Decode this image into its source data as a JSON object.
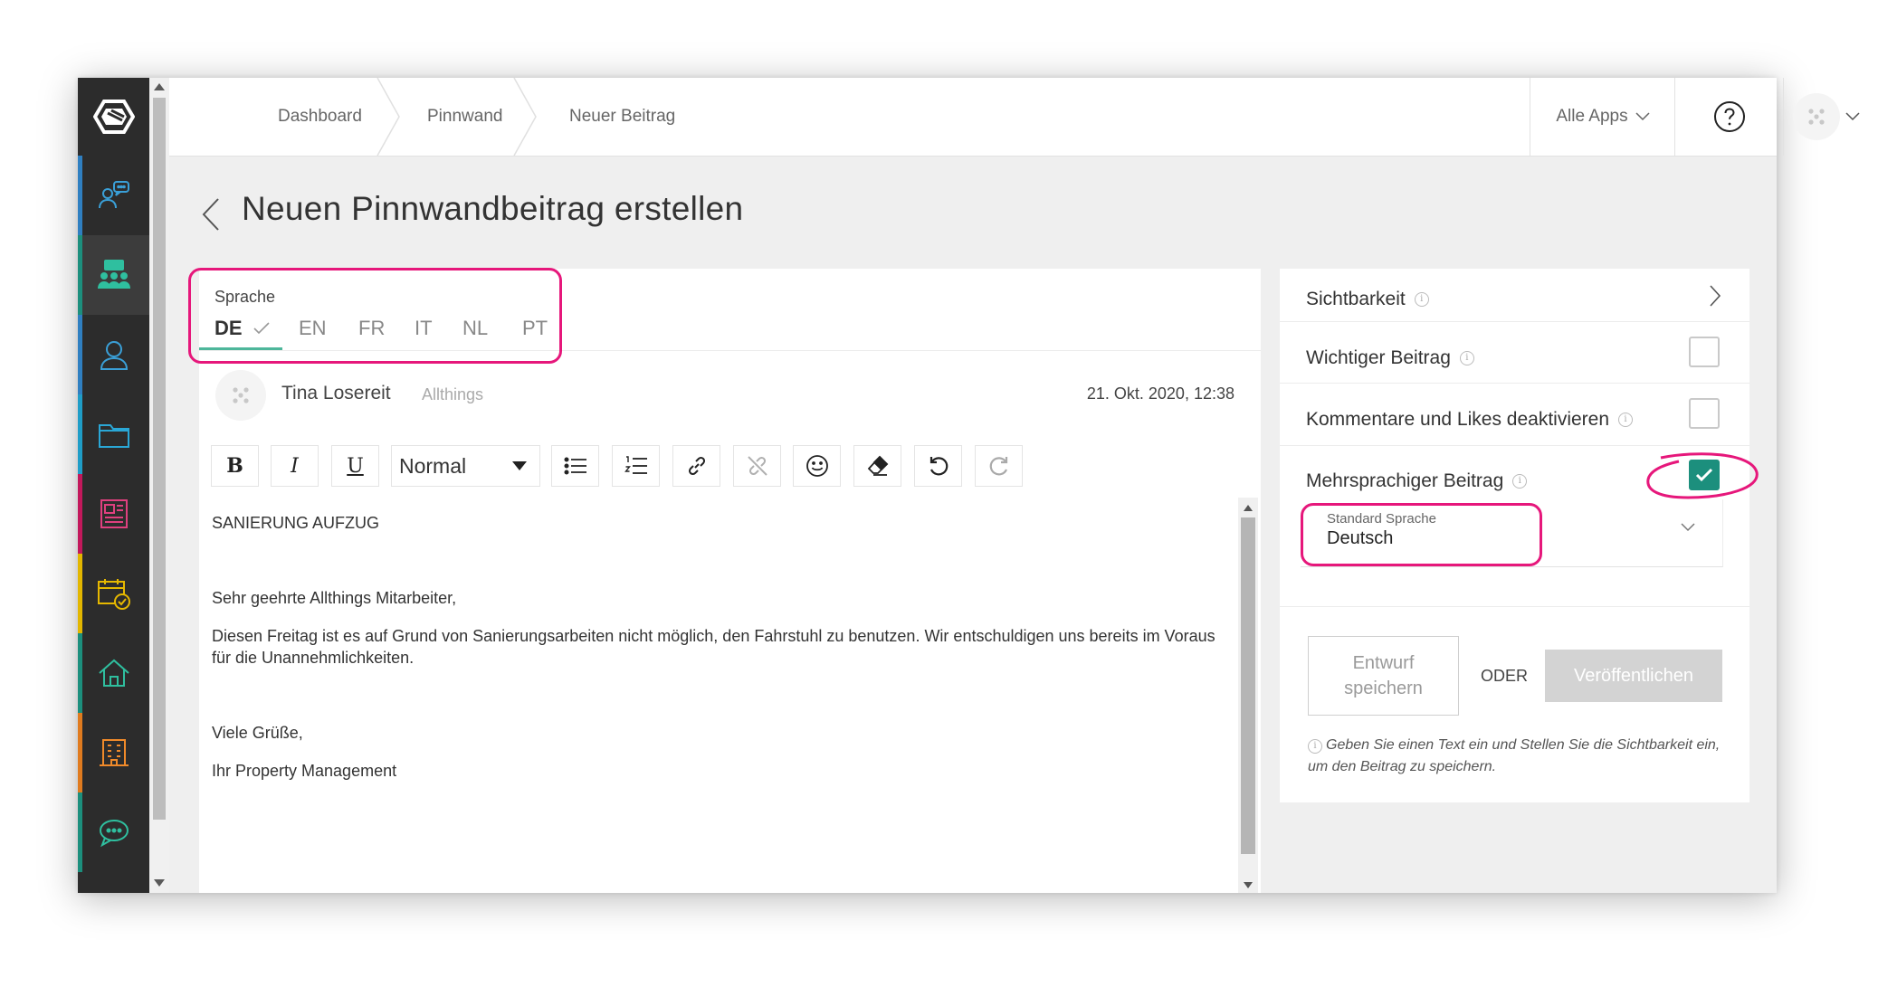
{
  "header": {
    "breadcrumb": [
      "Dashboard",
      "Pinnwand",
      "Neuer Beitrag"
    ],
    "apps_label": "Alle Apps"
  },
  "sidebar": {
    "icons": [
      {
        "name": "chat-bubbles-icon",
        "stripe": "#2f7fc1"
      },
      {
        "name": "community-icon",
        "stripe": "#1c8f7d"
      },
      {
        "name": "person-icon",
        "stripe": "#2f7fc1"
      },
      {
        "name": "folder-icon",
        "stripe": "#1f9dc7"
      },
      {
        "name": "newspaper-icon",
        "stripe": "#c2185b"
      },
      {
        "name": "calendar-check-icon",
        "stripe": "#e2b600"
      },
      {
        "name": "home-icon",
        "stripe": "#1c8f7d"
      },
      {
        "name": "building-icon",
        "stripe": "#e07b1f"
      },
      {
        "name": "chat-dots-icon",
        "stripe": "#1c8f7d"
      }
    ]
  },
  "page": {
    "title": "Neuen Pinnwandbeitrag erstellen"
  },
  "editor": {
    "language_label": "Sprache",
    "languages": [
      "DE",
      "EN",
      "FR",
      "IT",
      "NL",
      "PT"
    ],
    "active_language": "DE",
    "author": "Tina Losereit",
    "org": "Allthings",
    "date": "21. Okt. 2020, 12:38",
    "format": "Normal",
    "body": [
      "SANIERUNG AUFZUG",
      "Sehr geehrte Allthings Mitarbeiter,",
      "Diesen Freitag ist es auf Grund von Sanierungsarbeiten nicht möglich, den Fahrstuhl zu benutzen. Wir entschuldigen uns bereits im Voraus für die Unannehmlichkeiten.",
      "Viele Grüße,",
      "Ihr Property Management"
    ]
  },
  "settings": {
    "visibility": "Sichtbarkeit",
    "important": "Wichtiger Beitrag",
    "important_checked": false,
    "disable_comments": "Kommentare und Likes deaktivieren",
    "disable_comments_checked": false,
    "multilingual": "Mehrsprachiger Beitrag",
    "multilingual_checked": true,
    "std_lang_caption": "Standard Sprache",
    "std_lang_value": "Deutsch",
    "draft_line1": "Entwurf",
    "draft_line2": "speichern",
    "or": "ODER",
    "publish": "Veröffentlichen",
    "hint": "Geben Sie einen Text ein und Stellen Sie die Sichtbarkeit ein, um den Beitrag zu speichern."
  },
  "colors": {
    "accent": "#1c8f7d",
    "highlight": "#e6177b",
    "tab_underline": "#4db69a"
  }
}
